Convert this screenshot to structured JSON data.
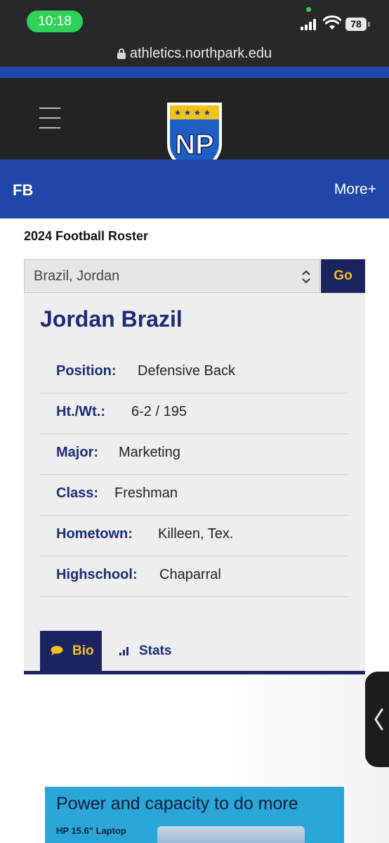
{
  "status_bar": {
    "time": "10:18",
    "battery": "78",
    "url": "athletics.northpark.edu"
  },
  "site": {
    "logo_text": "NP",
    "sport": "FB",
    "more_label": "More+",
    "colors": {
      "brand_blue": "#1e47a9",
      "navy": "#1c2460",
      "gold": "#f2c21d"
    }
  },
  "roster": {
    "title": "2024 Football Roster",
    "selected_player": "Brazil, Jordan",
    "go_label": "Go"
  },
  "player": {
    "name": "Jordan Brazil",
    "fields": [
      {
        "label": "Position",
        "value": "Defensive Back"
      },
      {
        "label": "Ht./Wt.",
        "value": "6-2 / 195"
      },
      {
        "label": "Major",
        "value": "Marketing"
      },
      {
        "label": "Class",
        "value": "Freshman"
      },
      {
        "label": "Hometown",
        "value": "Killeen, Tex."
      },
      {
        "label": "Highschool",
        "value": "Chaparral"
      }
    ]
  },
  "tabs": [
    {
      "label": "Bio",
      "icon": "chat-bubble-icon",
      "active": true
    },
    {
      "label": "Stats",
      "icon": "bar-chart-icon",
      "active": false
    }
  ],
  "ad": {
    "headline": "Power and capacity to do more",
    "subtext": "HP 15.6\" Laptop"
  }
}
